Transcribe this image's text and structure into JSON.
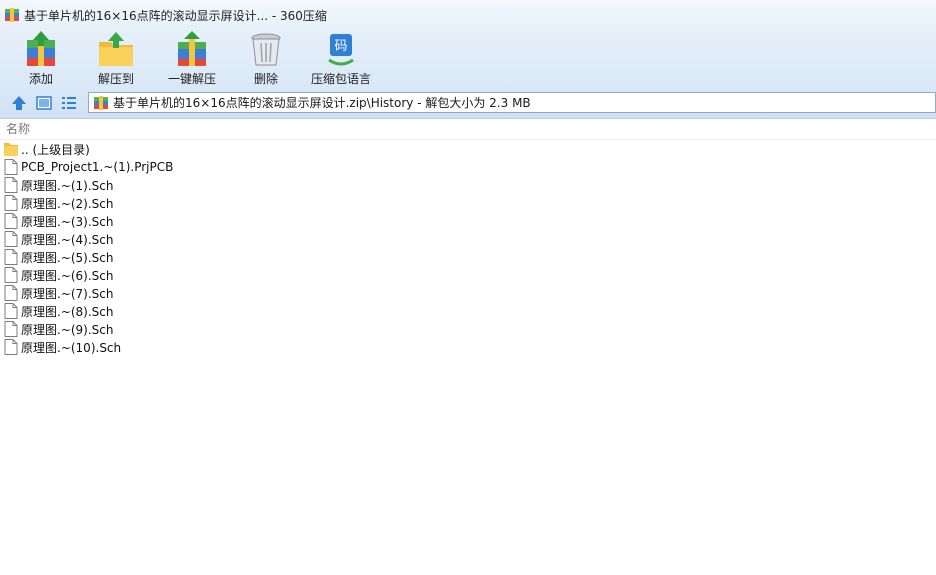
{
  "window": {
    "title": "基于单片机的16×16点阵的滚动显示屏设计... - 360压缩"
  },
  "toolbar": {
    "add_label": "添加",
    "extract_to_label": "解压到",
    "one_click_extract_label": "一键解压",
    "delete_label": "删除",
    "language_label": "压缩包语言",
    "language_icon_glyph": "码"
  },
  "address": {
    "path": "基于单片机的16×16点阵的滚动显示屏设计.zip\\History - 解包大小为 2.3 MB"
  },
  "list": {
    "column_name": "名称",
    "files": [
      {
        "name": ".. (上级目录)",
        "type": "folder"
      },
      {
        "name": "PCB_Project1.~(1).PrjPCB",
        "type": "file"
      },
      {
        "name": "原理图.~(1).Sch",
        "type": "file"
      },
      {
        "name": "原理图.~(2).Sch",
        "type": "file"
      },
      {
        "name": "原理图.~(3).Sch",
        "type": "file"
      },
      {
        "name": "原理图.~(4).Sch",
        "type": "file"
      },
      {
        "name": "原理图.~(5).Sch",
        "type": "file"
      },
      {
        "name": "原理图.~(6).Sch",
        "type": "file"
      },
      {
        "name": "原理图.~(7).Sch",
        "type": "file"
      },
      {
        "name": "原理图.~(8).Sch",
        "type": "file"
      },
      {
        "name": "原理图.~(9).Sch",
        "type": "file"
      },
      {
        "name": "原理图.~(10).Sch",
        "type": "file"
      }
    ]
  },
  "colors": {
    "accent_blue": "#2f7fd6",
    "folder_yellow": "#f6c94a",
    "archive_green": "#4caf50"
  }
}
